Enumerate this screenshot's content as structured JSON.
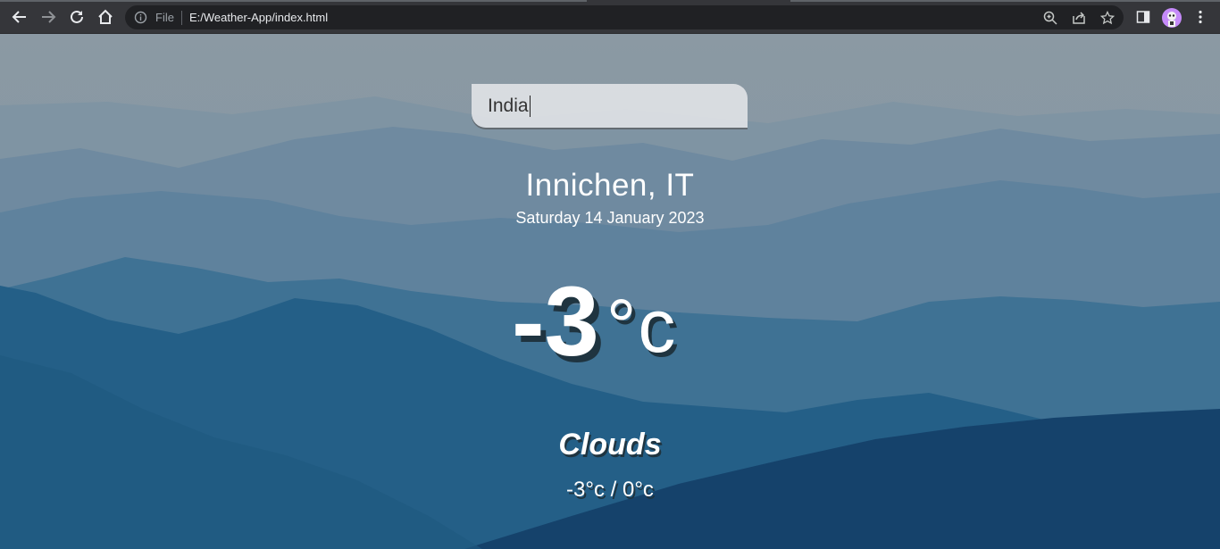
{
  "browser": {
    "file_label": "File",
    "url": "E:/Weather-App/index.html",
    "icons": {
      "back": "arrow-left-icon",
      "forward": "arrow-right-icon",
      "reload": "reload-icon",
      "home": "home-icon",
      "site_info": "info-icon",
      "zoom": "zoom-icon",
      "share": "share-icon",
      "bookmark": "star-icon",
      "side_panel": "side-panel-icon",
      "profile": "avatar",
      "menu": "kebab-menu-icon"
    }
  },
  "weather": {
    "search_value": "India",
    "city": "Innichen, IT",
    "date": "Saturday 14 January 2023",
    "temperature": "-3",
    "unit": "°c",
    "condition": "Clouds",
    "hi_low": "-3°c / 0°c"
  },
  "colors": {
    "chrome": "#35363a",
    "omnibox": "#202124",
    "sky": "#8a9aa6",
    "mountain_dark": "#1e5a7f",
    "text": "#ffffff"
  }
}
